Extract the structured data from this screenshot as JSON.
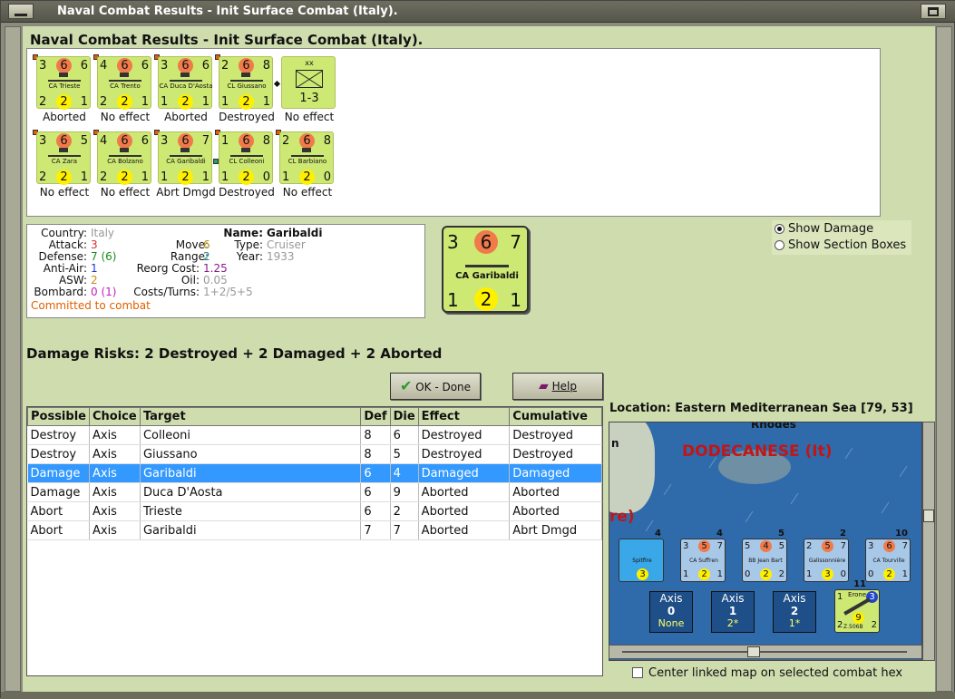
{
  "window": {
    "title": "Naval Combat Results - Init Surface Combat (Italy)."
  },
  "heading": "Naval Combat Results - Init Surface Combat (Italy).",
  "units_row1": [
    {
      "tl": "3",
      "top": "6",
      "tr": "6",
      "name": "CA Trieste",
      "bl": "2",
      "bot": "2",
      "br": "1",
      "result": "Aborted"
    },
    {
      "tl": "4",
      "top": "6",
      "tr": "6",
      "name": "CA Trento",
      "bl": "2",
      "bot": "2",
      "br": "1",
      "result": "No effect"
    },
    {
      "tl": "3",
      "top": "6",
      "tr": "6",
      "name": "CA Duca D'Aosta",
      "bl": "1",
      "bot": "2",
      "br": "1",
      "result": "Aborted"
    },
    {
      "tl": "2",
      "top": "6",
      "tr": "8",
      "name": "CL Giussano",
      "bl": "1",
      "bot": "2",
      "br": "1",
      "result": "Destroyed"
    }
  ],
  "division": {
    "label": "xx",
    "value": "1-3",
    "result": "No effect"
  },
  "units_row2": [
    {
      "tl": "3",
      "top": "6",
      "tr": "5",
      "name": "CA Zara",
      "bl": "2",
      "bot": "2",
      "br": "1",
      "result": "No effect"
    },
    {
      "tl": "4",
      "top": "6",
      "tr": "6",
      "name": "CA Bolzano",
      "bl": "2",
      "bot": "2",
      "br": "1",
      "result": "No effect"
    },
    {
      "tl": "3",
      "top": "6",
      "tr": "7",
      "name": "CA Garibaldi",
      "bl": "1",
      "bot": "2",
      "br": "1",
      "result": "Abrt Dmgd"
    },
    {
      "tl": "1",
      "top": "6",
      "tr": "8",
      "name": "CL Colleoni",
      "bl": "1",
      "bot": "2",
      "br": "0",
      "result": "Destroyed"
    },
    {
      "tl": "2",
      "top": "6",
      "tr": "8",
      "name": "CL Barbiano",
      "bl": "1",
      "bot": "2",
      "br": "0",
      "result": "No effect"
    }
  ],
  "info": {
    "country_label": "Country:",
    "country": "Italy",
    "attack_label": "Attack:",
    "attack": "3",
    "defense_label": "Defense:",
    "defense": "7 (6)",
    "antiair_label": "Anti-Air:",
    "antiair": "1",
    "asw_label": "ASW:",
    "asw": "2",
    "bombard_label": "Bombard:",
    "bombard": "0 (1)",
    "committed": "Committed to combat",
    "name_label": "Name:",
    "name": "Garibaldi",
    "type_label": "Type:",
    "type": "Cruiser",
    "year_label": "Year:",
    "year": "1933",
    "move_label": "Move:",
    "move": "6",
    "range_label": "Range:",
    "range": "2",
    "reorg_label": "Reorg Cost:",
    "reorg": "1.25",
    "oil_label": "Oil:",
    "oil": "0.05",
    "costs_label": "Costs/Turns:",
    "costs": "1+2/5+5"
  },
  "big_chit": {
    "tl": "3",
    "top": "6",
    "tr": "7",
    "name": "CA Garibaldi",
    "bl": "1",
    "bot": "2",
    "br": "1"
  },
  "options": {
    "show_damage": "Show Damage",
    "show_sections": "Show Section Boxes"
  },
  "damage_risks": "Damage Risks:  2 Destroyed + 2 Damaged + 2 Aborted",
  "buttons": {
    "ok": "OK - Done",
    "help": "Help"
  },
  "table": {
    "headers": [
      "Possible",
      "Choice",
      "Target",
      "Def",
      "Die",
      "Effect",
      "Cumulative"
    ],
    "rows": [
      [
        "Destroy",
        "Axis",
        "Colleoni",
        "8",
        "6",
        "Destroyed",
        "Destroyed"
      ],
      [
        "Destroy",
        "Axis",
        "Giussano",
        "8",
        "5",
        "Destroyed",
        "Destroyed"
      ],
      [
        "Damage",
        "Axis",
        "Garibaldi",
        "6",
        "4",
        "Damaged",
        "Damaged"
      ],
      [
        "Damage",
        "Axis",
        "Duca D'Aosta",
        "6",
        "9",
        "Aborted",
        "Aborted"
      ],
      [
        "Abort",
        "Axis",
        "Trieste",
        "6",
        "2",
        "Aborted",
        "Aborted"
      ],
      [
        "Abort",
        "Axis",
        "Garibaldi",
        "7",
        "7",
        "Aborted",
        "Abrt Dmgd"
      ]
    ]
  },
  "location": "Location:  Eastern Mediterranean Sea [79, 53]",
  "map": {
    "region": "DODECANESE (It)",
    "rhodes": "Rhodes",
    "n": "n",
    "re": "re)",
    "chits": [
      {
        "count": "4",
        "tl": "",
        "top": "",
        "tr": "",
        "name": "Spitfire",
        "bl": "",
        "bot": "3",
        "br": ""
      },
      {
        "count": "4",
        "tl": "3",
        "top": "5",
        "tr": "7",
        "name": "CA Suffren",
        "bl": "1",
        "bot": "2",
        "br": "1"
      },
      {
        "count": "5",
        "tl": "5",
        "top": "4",
        "tr": "5",
        "name": "BB Jean Bart",
        "bl": "0",
        "bot": "2",
        "br": "2"
      },
      {
        "count": "2",
        "tl": "2",
        "top": "5",
        "tr": "7",
        "name": "Galissonnière",
        "bl": "1",
        "bot": "3",
        "br": "0"
      },
      {
        "count": "10",
        "tl": "3",
        "top": "6",
        "tr": "7",
        "name": "CA Tourville",
        "bl": "0",
        "bot": "2",
        "br": "1"
      }
    ],
    "axis": [
      {
        "label": "Axis",
        "value": "0",
        "sub": "None"
      },
      {
        "label": "Axis",
        "value": "1",
        "sub": "2*"
      },
      {
        "label": "Axis",
        "value": "2",
        "sub": "1*"
      }
    ],
    "plane": {
      "count": "11",
      "name": "Erone",
      "model": "Z.506B",
      "tl": "1",
      "circle": "3",
      "bot": "9",
      "bl": "2",
      "br": "2"
    }
  },
  "center_link": "Center linked map on selected combat hex",
  "colors": {
    "bg": "#cfdcae",
    "chit": "#cde873",
    "selection": "#3399ff",
    "region": "#c21616"
  }
}
